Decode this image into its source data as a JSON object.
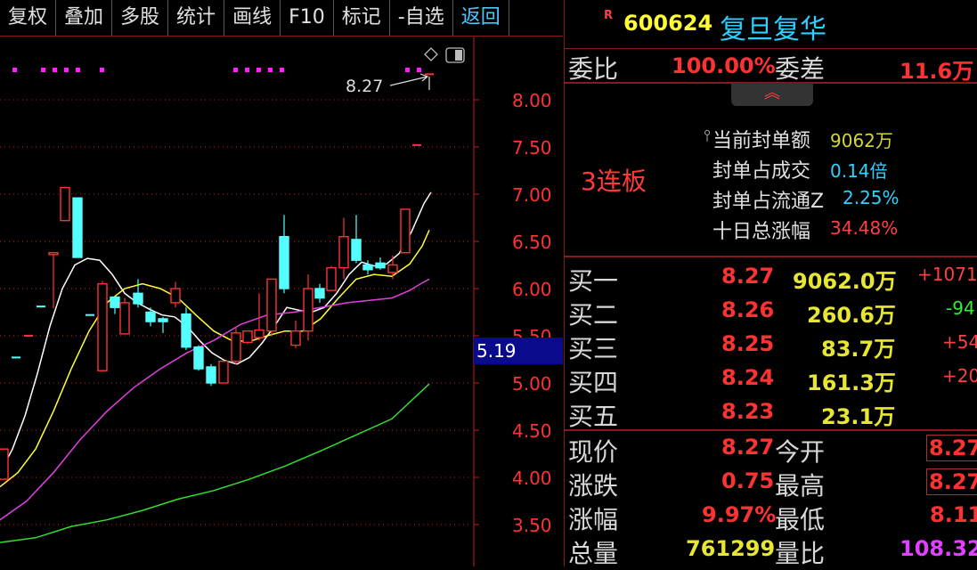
{
  "toolbar": {
    "items": [
      "复权",
      "叠加",
      "多股",
      "统计",
      "画线",
      "F10",
      "标记",
      "-自选",
      "返回"
    ]
  },
  "chart": {
    "high_marker": "8.27",
    "price_tag": "5.19",
    "y_axis": {
      "min": 3.25,
      "max": 8.25,
      "ticks": [
        "8.00",
        "7.50",
        "7.00",
        "6.50",
        "6.00",
        "5.50",
        "5.00",
        "4.50",
        "4.00",
        "3.50"
      ]
    },
    "icons": [
      "diamond-icon",
      "window-toggle-icon"
    ],
    "colors": {
      "up": "#ff3232",
      "down": "#54ffff",
      "ma5": "#ffffff",
      "ma10": "#ffff33",
      "ma20": "#e040e0",
      "ma60": "#33dd33",
      "grid": "#c81e1e"
    }
  },
  "stock": {
    "badge": "R",
    "code": "600624",
    "name": "复旦复华"
  },
  "order_ratio": {
    "label1": "委比",
    "value1": "100.00%",
    "label2": "委差",
    "value2": "11.6万"
  },
  "limit_info": {
    "board": "3连板",
    "rows": [
      {
        "label": "当前封单额",
        "value": "9062万"
      },
      {
        "label": "封单占成交",
        "value": "0.14倍"
      },
      {
        "label": "封单占流通Z",
        "value": "2.25%"
      },
      {
        "label": "十日总涨幅",
        "value": "34.48%"
      }
    ]
  },
  "bids": [
    {
      "label": "买一",
      "price": "8.27",
      "volume": "9062.0万",
      "change": "+1071"
    },
    {
      "label": "买二",
      "price": "8.26",
      "volume": "260.6万",
      "change": "-94"
    },
    {
      "label": "买三",
      "price": "8.25",
      "volume": "83.7万",
      "change": "+54"
    },
    {
      "label": "买四",
      "price": "8.24",
      "volume": "161.3万",
      "change": "+20"
    },
    {
      "label": "买五",
      "price": "8.23",
      "volume": "23.1万",
      "change": ""
    }
  ],
  "quote": [
    {
      "label": "现价",
      "value": "8.27",
      "label2": "今开",
      "value2": "8.27"
    },
    {
      "label": "涨跌",
      "value": "0.75",
      "label2": "最高",
      "value2": "8.27"
    },
    {
      "label": "涨幅",
      "value": "9.97%",
      "label2": "最低",
      "value2": "8.11"
    },
    {
      "label": "总量",
      "value": "761299",
      "label2": "量比",
      "value2": "108.32"
    }
  ]
}
